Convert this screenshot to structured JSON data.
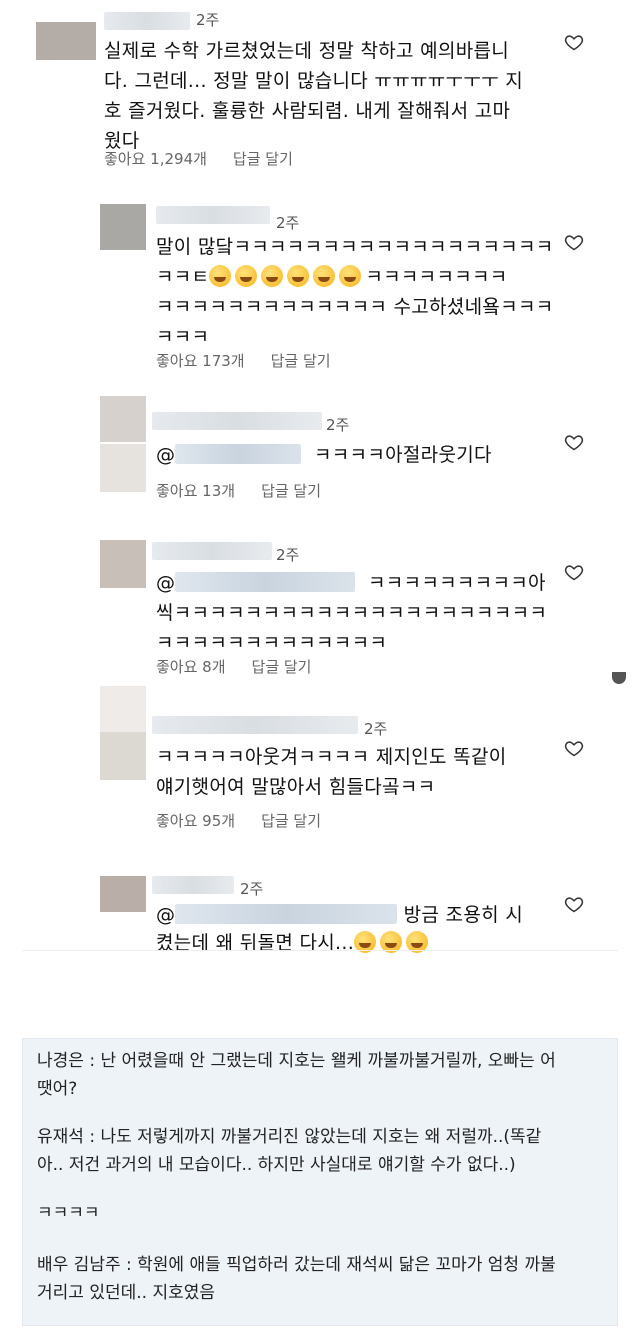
{
  "comments": [
    {
      "time": "2주",
      "text": "실제로 수학 가르쳤었는데 정말 착하고 예의바릅니\n다. 그런데... 정말 말이 많습니다 ㅠㅠㅠㅠㅜㅜㅜ 지\n호 즐거웠다. 훌륭한 사람되렴. 내게 잘해줘서 고마\n웠다",
      "likes": "좋아요 1,294개",
      "reply": "답글 달기"
    },
    {
      "time": "2주",
      "text_a": "말이 많닼ㅋㅋㅋㅋㅋㅋㅋㅋㅋㅋㅋㅋㅋㅋㅋㅋㅋㅋ",
      "text_b": "ㅋㅋㅌ",
      "text_b2": "ㅋㅋㅋㅋㅋㅋㅋㅋ",
      "text_c": "ㅋㅋㅋㅋㅋㅋㅋㅋㅋㅋㅋㅋㅋ 수고하셨네욬ㅋㅋㅋ\nㅋㅋㅋ",
      "likes": "좋아요 173개",
      "reply": "답글 달기"
    },
    {
      "time": "2주",
      "mention": "@",
      "text": "ㅋㅋㅋㅋ아절라웃기다",
      "likes": "좋아요 13개",
      "reply": "답글 달기"
    },
    {
      "time": "2주",
      "mention": "@",
      "text_a": "ㅋㅋㅋㅋㅋㅋㅋㅋㅋ아",
      "text_b": "씩ㅋㅋㅋㅋㅋㅋㅋㅋㅋㅋㅋㅋㅋㅋㅋㅋㅋㅋㅋㅋㅋ\nㅋㅋㅋㅋㅋㅋㅋㅋㅋㅋㅋㅋㅋ",
      "likes": "좋아요 8개",
      "reply": "답글 달기"
    },
    {
      "time": "2주",
      "text": "ㅋㅋㅋㅋㅋ아웃겨ㅋㅋㅋㅋ 제지인도 똑같이\n얘기햇어여 말많아서 힘들다곸ㅋㅋ",
      "likes": "좋아요 95개",
      "reply": "답글 달기"
    },
    {
      "time": "2주",
      "mention": "@",
      "text_a": "방금 조용히 시",
      "text_b": "켰는데 왜 뒤돌면 다시..."
    }
  ],
  "quote": {
    "line1": "나경은 : 난 어렸을때 안 그랬는데 지호는 왤케 까불까불거릴까, 오빠는 어",
    "line2": "땟어?",
    "line3": "유재석 : 나도 저렇게까지 까불거리진 않았는데 지호는 왜 저럴까..(똑같",
    "line4": "아.. 저건 과거의 내 모습이다.. 하지만 사실대로 얘기할 수가 없다..)",
    "line5": "ㅋㅋㅋㅋ",
    "line6": "배우 김남주 : 학원에 애들 픽업하러 갔는데 재석씨 닮은 꼬마가 엄청 까불",
    "line7": "거리고 있던데.. 지호였음"
  },
  "icons": {
    "heart": "heart-outline-icon",
    "emoji": "smiling-face-emoji"
  }
}
